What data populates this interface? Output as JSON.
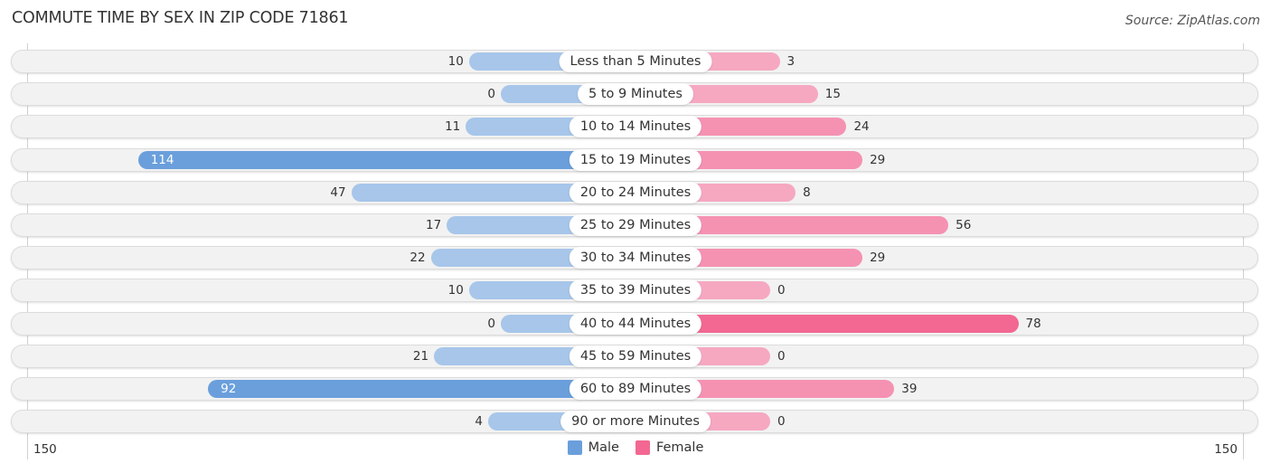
{
  "title": "COMMUTE TIME BY SEX IN ZIP CODE 71861",
  "source": "Source: ZipAtlas.com",
  "colors": {
    "male_light": "#a7c6ea",
    "male_strong": "#6a9fdc",
    "female_light": "#f6a8c1",
    "female_strong": "#f26892",
    "row_bg": "#f2f2f2"
  },
  "legend": {
    "male": "Male",
    "female": "Female"
  },
  "axis": {
    "left_tick": "150",
    "right_tick": "150"
  },
  "chart_data": {
    "type": "bar",
    "orientation": "horizontal-diverging",
    "title": "COMMUTE TIME BY SEX IN ZIP CODE 71861",
    "xlim": [
      -150,
      150
    ],
    "legend_position": "bottom-center",
    "categories": [
      "Less than 5 Minutes",
      "5 to 9 Minutes",
      "10 to 14 Minutes",
      "15 to 19 Minutes",
      "20 to 24 Minutes",
      "25 to 29 Minutes",
      "30 to 34 Minutes",
      "35 to 39 Minutes",
      "40 to 44 Minutes",
      "45 to 59 Minutes",
      "60 to 89 Minutes",
      "90 or more Minutes"
    ],
    "series": [
      {
        "name": "Male",
        "values": [
          10,
          0,
          11,
          114,
          47,
          17,
          22,
          10,
          0,
          21,
          92,
          4
        ]
      },
      {
        "name": "Female",
        "values": [
          3,
          15,
          24,
          29,
          8,
          56,
          29,
          0,
          78,
          0,
          39,
          0
        ]
      }
    ]
  }
}
